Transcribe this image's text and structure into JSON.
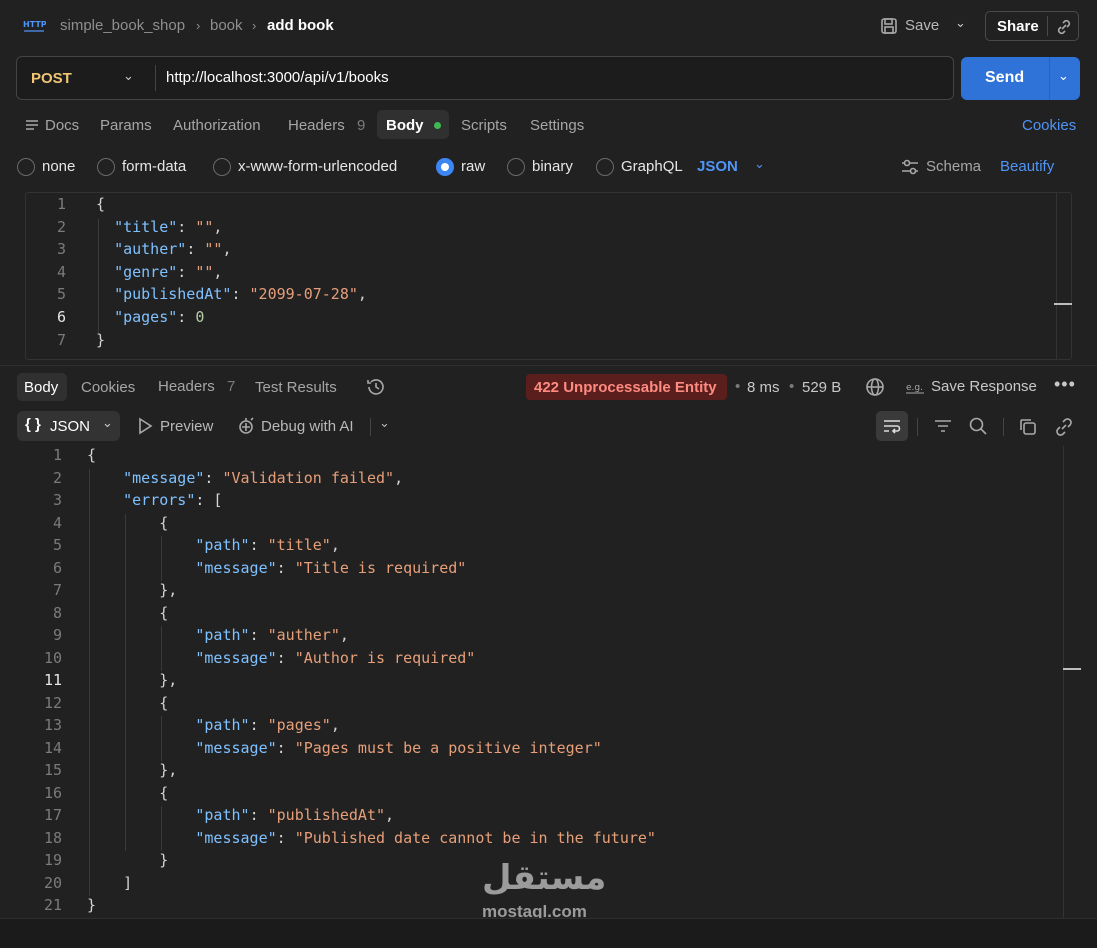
{
  "header": {
    "breadcrumb": [
      "simple_book_shop",
      "book",
      "add book"
    ],
    "save_label": "Save",
    "share_label": "Share"
  },
  "request": {
    "method": "POST",
    "url": "http://localhost:3000/api/v1/books",
    "send_label": "Send"
  },
  "request_tabs": {
    "docs": "Docs",
    "params": "Params",
    "authorization": "Authorization",
    "headers": "Headers",
    "headers_count": "9",
    "body": "Body",
    "scripts": "Scripts",
    "settings": "Settings",
    "cookies": "Cookies"
  },
  "body_types": {
    "options": [
      "none",
      "form-data",
      "x-www-form-urlencoded",
      "raw",
      "binary",
      "GraphQL"
    ],
    "selected": "raw",
    "format": "JSON",
    "schema_label": "Schema",
    "beautify_label": "Beautify"
  },
  "request_body": {
    "line_numbers": [
      "1",
      "2",
      "3",
      "4",
      "5",
      "6",
      "7"
    ],
    "fields": [
      {
        "key": "\"title\"",
        "value": "\"\""
      },
      {
        "key": "\"auther\"",
        "value": "\"\""
      },
      {
        "key": "\"genre\"",
        "value": "\"\""
      },
      {
        "key": "\"publishedAt\"",
        "value": "\"2099-07-28\""
      },
      {
        "key": "\"pages\"",
        "value": "0"
      }
    ]
  },
  "response_tabs": {
    "body": "Body",
    "cookies": "Cookies",
    "headers": "Headers",
    "headers_count": "7",
    "test_results": "Test Results"
  },
  "response_meta": {
    "status": "422 Unprocessable Entity",
    "time": "8 ms",
    "size": "529 B",
    "save_response": "Save Response",
    "status_color": "#ff8a80"
  },
  "response_toolbar": {
    "format": "JSON",
    "preview": "Preview",
    "debug": "Debug with AI"
  },
  "response_body": {
    "line_numbers": [
      "1",
      "2",
      "3",
      "4",
      "5",
      "6",
      "7",
      "8",
      "9",
      "10",
      "11",
      "12",
      "13",
      "14",
      "15",
      "16",
      "17",
      "18",
      "19",
      "20",
      "21"
    ],
    "message_key": "\"message\"",
    "message_value": "\"Validation failed\"",
    "errors_key": "\"errors\"",
    "errors": [
      {
        "path_key": "\"path\"",
        "path": "\"title\"",
        "message_key": "\"message\"",
        "message": "\"Title is required\""
      },
      {
        "path_key": "\"path\"",
        "path": "\"auther\"",
        "message_key": "\"message\"",
        "message": "\"Author is required\""
      },
      {
        "path_key": "\"path\"",
        "path": "\"pages\"",
        "message_key": "\"message\"",
        "message": "\"Pages must be a positive integer\""
      },
      {
        "path_key": "\"path\"",
        "path": "\"publishedAt\"",
        "message_key": "\"message\"",
        "message": "\"Published date cannot be in the future\""
      }
    ]
  },
  "watermark": {
    "arabic": "مستقل",
    "latin": "mostaql.com"
  },
  "colors": {
    "accent": "#2f72d8",
    "method": "#f0c674",
    "json_key": "#7fc1ff",
    "json_string": "#e79f79"
  }
}
